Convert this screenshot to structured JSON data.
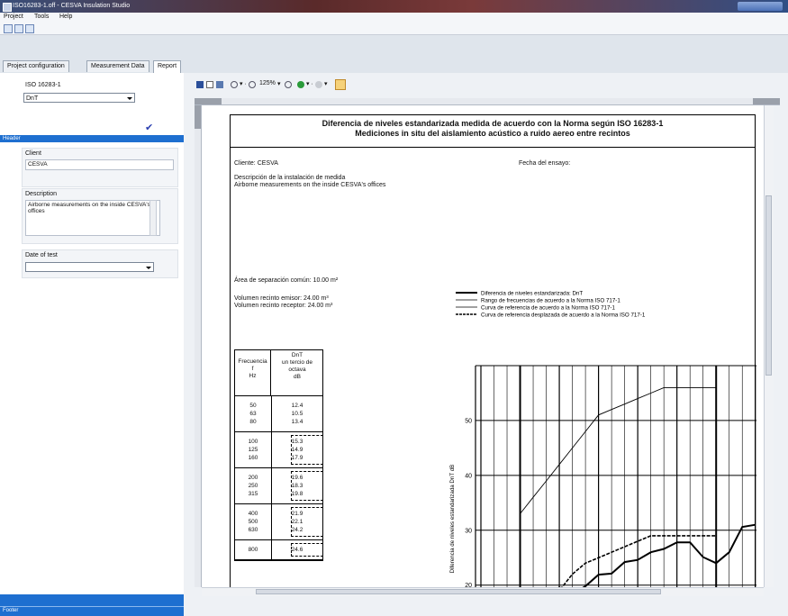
{
  "window": {
    "title": "ISO16283-1.off - CESVA Insulation Studio"
  },
  "menu": [
    "Project",
    "Tools",
    "Help"
  ],
  "tabs": [
    {
      "label": "Project configuration",
      "active": false
    },
    {
      "label": "Measurement Data",
      "active": false
    },
    {
      "label": "Report",
      "active": true
    }
  ],
  "left": {
    "standard_label": "ISO 16283-1",
    "parameter_value": "DnT",
    "header_section": "Header",
    "client_label": "Client",
    "client_value": "CESVA",
    "description_label": "Description",
    "description_value": "Airborne measurements on the inside CESVA's offices",
    "date_label": "Date of test",
    "date_value": "",
    "footer_section": "Footer"
  },
  "report_toolbar": {
    "zoom": "125%"
  },
  "report": {
    "title_line1": "Diferencia de niveles estandarizada medida de acuerdo con la Norma según ISO 16283-1",
    "title_line2": "Mediciones in situ del aislamiento acústico a ruido aereo entre recintos",
    "client_label": "Cliente:",
    "client_value": "CESVA",
    "date_label": "Fecha del ensayo:",
    "install_label": "Descripción de la instalación de medida",
    "install_value": "Airborne measurements on the inside CESVA's offices",
    "area_label": "Área de separación común:",
    "area_value": "10.00 m²",
    "vol_emisor_label": "Volumen recinto emisor:",
    "vol_emisor_value": "24.00 m³",
    "vol_receptor_label": "Volumen recinto receptor:",
    "vol_receptor_value": "24.00 m³",
    "table": {
      "col1": [
        "Frecuencia",
        "f",
        "Hz"
      ],
      "col2": [
        "DnT",
        "un tercio de",
        "octava",
        "dB"
      ],
      "groups": [
        [
          [
            "50",
            "12.4"
          ],
          [
            "63",
            "10.5"
          ],
          [
            "80",
            "13.4"
          ]
        ],
        [
          [
            "100",
            "15.3"
          ],
          [
            "125",
            "14.9"
          ],
          [
            "160",
            "17.9"
          ]
        ],
        [
          [
            "200",
            "19.6"
          ],
          [
            "250",
            "18.3"
          ],
          [
            "315",
            "19.8"
          ]
        ],
        [
          [
            "400",
            "21.9"
          ],
          [
            "500",
            "22.1"
          ],
          [
            "630",
            "24.2"
          ]
        ],
        [
          [
            "800",
            "24.6"
          ]
        ]
      ]
    }
  },
  "chart_data": {
    "type": "line",
    "ylabel": "Diferencia de niveles estandarizada DnT dB",
    "yticks": [
      20,
      30,
      40,
      50
    ],
    "ylim": [
      17,
      60
    ],
    "legend": [
      "Diferencia de niveles estandarizada: DnT",
      "Rango de frecuencias de acuerdo a la Norma ISO 717-1",
      "Curva de referencia de acuerdo a la Norma ISO 717-1",
      "Curva de referencia desplazada de acuerdo a la Norma ISO 717-1"
    ],
    "series": [
      {
        "name": "Diferencia de niveles estandarizada: DnT",
        "values": [
          12.4,
          10.5,
          13.4,
          15.3,
          14.9,
          17.9,
          19.6,
          18.3,
          19.8,
          21.9,
          22.1,
          24.2,
          24.6,
          26.0,
          26.6,
          27.8,
          27.8,
          25.1,
          24.0,
          26.0,
          30.6,
          31.0
        ]
      },
      {
        "name": "Curva de referencia de acuerdo a la Norma ISO 717-1",
        "values": [
          33,
          36,
          39,
          42,
          45,
          48,
          51,
          52,
          53,
          54,
          55,
          56,
          56,
          56,
          56,
          56
        ]
      },
      {
        "name": "Curva de referencia desplazada de acuerdo a la Norma ISO 717-1",
        "values": [
          10,
          13,
          16,
          19,
          22,
          24,
          25,
          26,
          27,
          28,
          29,
          29,
          29,
          29,
          29,
          29
        ]
      }
    ]
  }
}
